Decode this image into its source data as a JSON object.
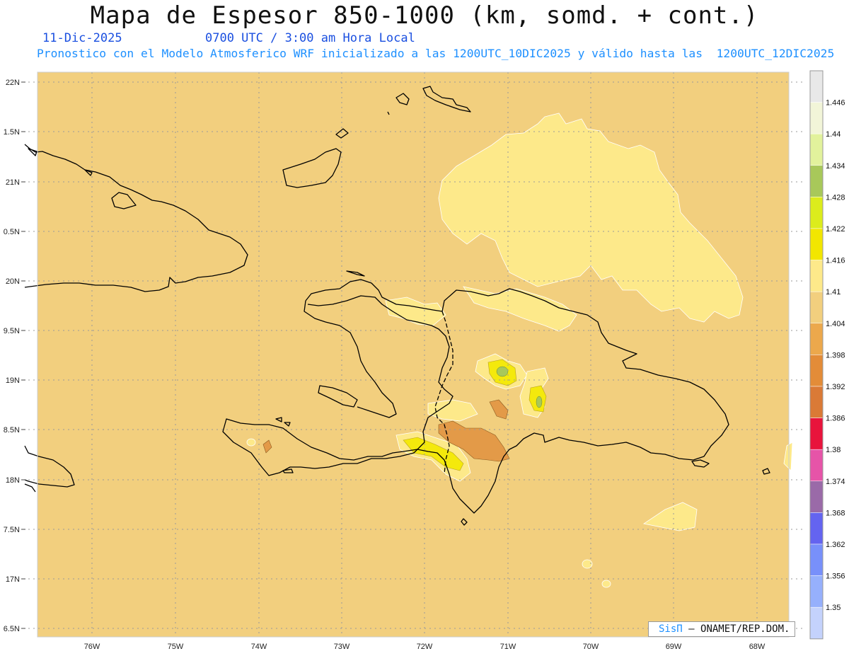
{
  "title": "Mapa de Espesor 850-1000 (km, somd. + cont.)",
  "date": "11-Dic-2025",
  "time": "0700 UTC / 3:00 am Hora Local",
  "forecast_line": "Pronostico con el Modelo Atmosferico WRF inicializado a las 1200UTC_10DIC2025 y válido hasta las  1200UTC_12DIC2025",
  "credit": {
    "brand": "SisΠ",
    "org": "– ONAMET/REP.DOM."
  },
  "lat_labels": [
    "22N",
    "1.5N",
    "21N",
    "0.5N",
    "20N",
    "9.5N",
    "19N",
    "8.5N",
    "18N",
    "7.5N",
    "17N",
    "6.5N"
  ],
  "lon_labels": [
    "76W",
    "75W",
    "74W",
    "73W",
    "72W",
    "71W",
    "70W",
    "69W",
    "68W"
  ],
  "legend": [
    {
      "label": "",
      "color": "#e8e8e8"
    },
    {
      "label": "1.446",
      "color": "#f2f5d8"
    },
    {
      "label": "1.44",
      "color": "#e2f29c"
    },
    {
      "label": "1.434",
      "color": "#a8c85a"
    },
    {
      "label": "1.428",
      "color": "#dcec1c"
    },
    {
      "label": "1.422",
      "color": "#f2e600"
    },
    {
      "label": "1.416",
      "color": "#fde98a"
    },
    {
      "label": "1.41",
      "color": "#f2cf7e"
    },
    {
      "label": "1.404",
      "color": "#eca84c"
    },
    {
      "label": "1.398",
      "color": "#e38c38"
    },
    {
      "label": "1.392",
      "color": "#da7a36"
    },
    {
      "label": "1.386",
      "color": "#e8143c"
    },
    {
      "label": "1.38",
      "color": "#e654a8"
    },
    {
      "label": "1.374",
      "color": "#9a6aa8"
    },
    {
      "label": "1.368",
      "color": "#6464f0"
    },
    {
      "label": "1.362",
      "color": "#7890fa"
    },
    {
      "label": "1.356",
      "color": "#96b0fc"
    },
    {
      "label": "1.35",
      "color": "#c4d2fc"
    }
  ],
  "colors": {
    "background_field": "#f2cf7e",
    "level_1410": "#fde98a",
    "level_1398": "#e39a48",
    "level_1422": "#f4e90c",
    "level_1428": "#a8c85a",
    "coast": "#000000",
    "grid": "#9a9a9a"
  }
}
